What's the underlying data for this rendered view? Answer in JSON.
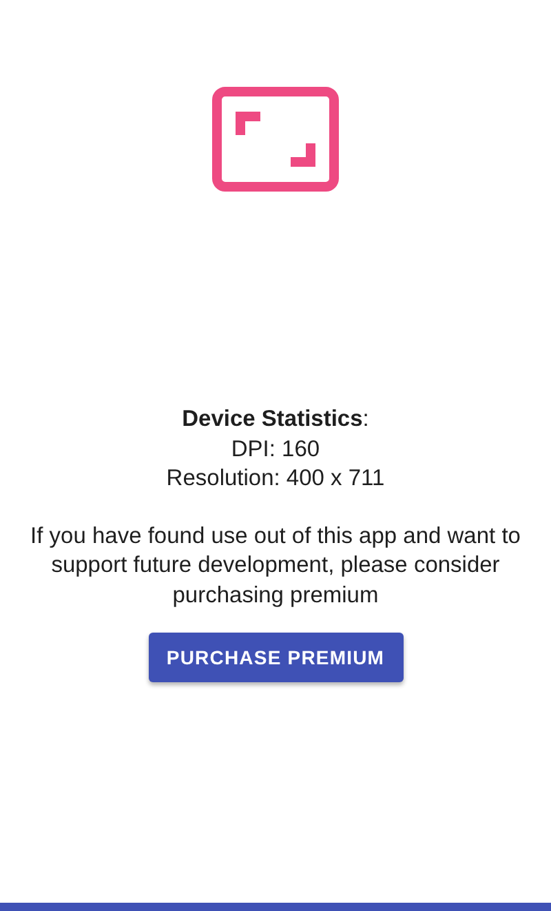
{
  "stats": {
    "heading": "Device Statistics",
    "heading_suffix": ":",
    "lines": [
      "DPI: 160",
      "Resolution: 400 x 711"
    ]
  },
  "message": "If you have found use out of this app and want to support future development, please consider purchasing premium",
  "button": {
    "label": "PURCHASE PREMIUM"
  }
}
